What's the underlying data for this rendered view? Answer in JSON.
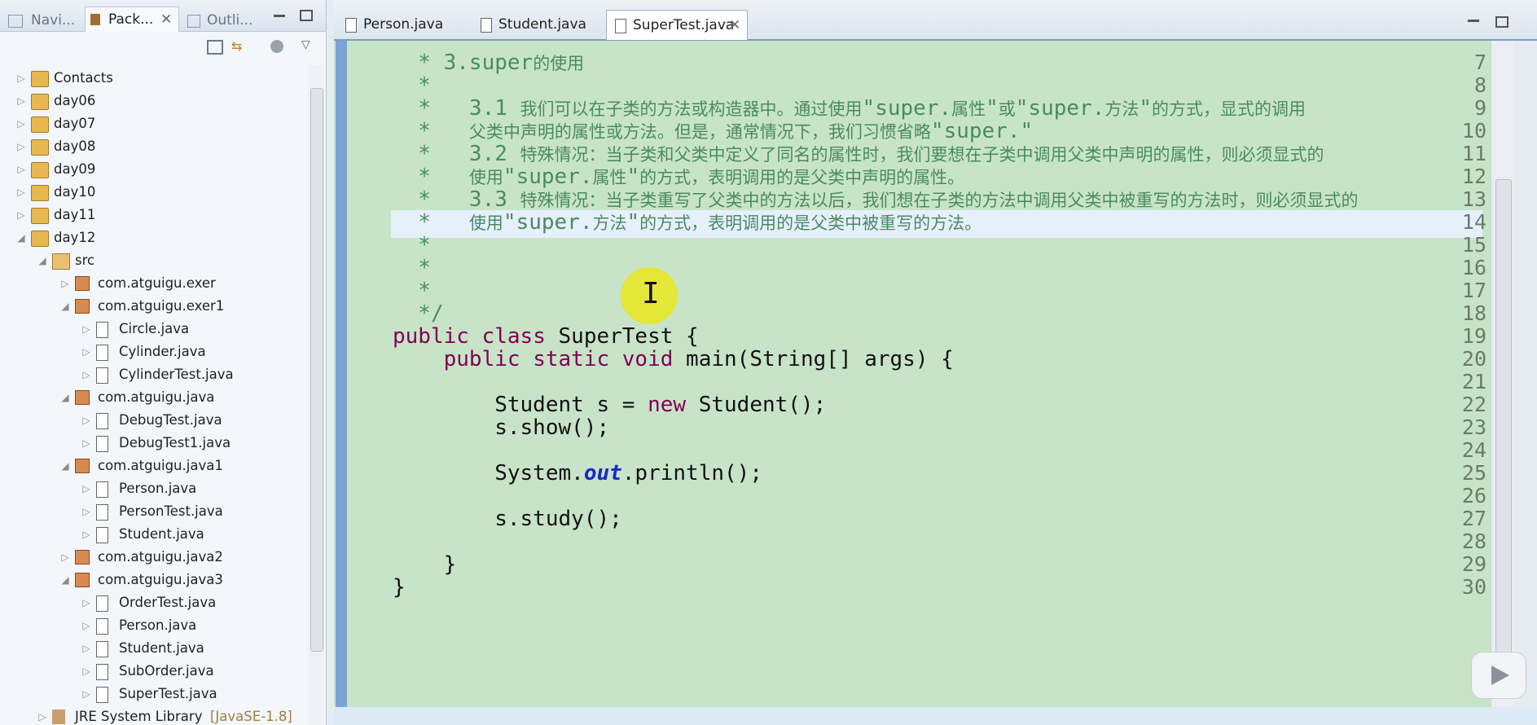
{
  "left_panel": {
    "tabs": [
      {
        "label": "Navi...",
        "icon": "navigator-icon"
      },
      {
        "label": "Pack...",
        "icon": "package-explorer-icon",
        "active": true
      },
      {
        "label": "Outli...",
        "icon": "outline-icon"
      }
    ],
    "tree": [
      {
        "label": "Contacts",
        "level": 0,
        "kind": "project",
        "expanded": false
      },
      {
        "label": "day06",
        "level": 0,
        "kind": "project",
        "expanded": false
      },
      {
        "label": "day07",
        "level": 0,
        "kind": "project",
        "expanded": false
      },
      {
        "label": "day08",
        "level": 0,
        "kind": "project",
        "expanded": false
      },
      {
        "label": "day09",
        "level": 0,
        "kind": "project",
        "expanded": false
      },
      {
        "label": "day10",
        "level": 0,
        "kind": "project",
        "expanded": false
      },
      {
        "label": "day11",
        "level": 0,
        "kind": "project",
        "expanded": false
      },
      {
        "label": "day12",
        "level": 0,
        "kind": "project",
        "expanded": true
      },
      {
        "label": "src",
        "level": 1,
        "kind": "src",
        "expanded": true
      },
      {
        "label": "com.atguigu.exer",
        "level": 2,
        "kind": "package",
        "expanded": false
      },
      {
        "label": "com.atguigu.exer1",
        "level": 2,
        "kind": "package",
        "expanded": true
      },
      {
        "label": "Circle.java",
        "level": 3,
        "kind": "file"
      },
      {
        "label": "Cylinder.java",
        "level": 3,
        "kind": "file"
      },
      {
        "label": "CylinderTest.java",
        "level": 3,
        "kind": "file"
      },
      {
        "label": "com.atguigu.java",
        "level": 2,
        "kind": "package",
        "expanded": true
      },
      {
        "label": "DebugTest.java",
        "level": 3,
        "kind": "file"
      },
      {
        "label": "DebugTest1.java",
        "level": 3,
        "kind": "file"
      },
      {
        "label": "com.atguigu.java1",
        "level": 2,
        "kind": "package",
        "expanded": true
      },
      {
        "label": "Person.java",
        "level": 3,
        "kind": "file"
      },
      {
        "label": "PersonTest.java",
        "level": 3,
        "kind": "file"
      },
      {
        "label": "Student.java",
        "level": 3,
        "kind": "file"
      },
      {
        "label": "com.atguigu.java2",
        "level": 2,
        "kind": "package",
        "expanded": false
      },
      {
        "label": "com.atguigu.java3",
        "level": 2,
        "kind": "package",
        "expanded": true
      },
      {
        "label": "OrderTest.java",
        "level": 3,
        "kind": "file"
      },
      {
        "label": "Person.java",
        "level": 3,
        "kind": "file"
      },
      {
        "label": "Student.java",
        "level": 3,
        "kind": "file"
      },
      {
        "label": "SubOrder.java",
        "level": 3,
        "kind": "file"
      },
      {
        "label": "SuperTest.java",
        "level": 3,
        "kind": "file"
      },
      {
        "label": "JRE System Library",
        "suffix": "[JavaSE-1.8]",
        "level": 1,
        "kind": "library",
        "expanded": false
      }
    ]
  },
  "editor": {
    "tabs": [
      {
        "label": "Person.java",
        "active": false
      },
      {
        "label": "Student.java",
        "active": false
      },
      {
        "label": "SuperTest.java",
        "active": true
      }
    ],
    "highlighted_line": 14,
    "lines": [
      {
        "n": "7",
        "segs": [
          {
            "c": "cm",
            "t": "  * 3.super"
          },
          {
            "c": "cmz",
            "t": "的使用"
          }
        ]
      },
      {
        "n": "8",
        "segs": [
          {
            "c": "cm",
            "t": "  *"
          }
        ]
      },
      {
        "n": "9",
        "segs": [
          {
            "c": "cm",
            "t": "  *   3.1 "
          },
          {
            "c": "cmz",
            "t": "我们可以在子类的方法或构造器中。通过使用"
          },
          {
            "c": "cm",
            "t": "\"super."
          },
          {
            "c": "cmz",
            "t": "属性"
          },
          {
            "c": "cm",
            "t": "\""
          },
          {
            "c": "cmz",
            "t": "或"
          },
          {
            "c": "cm",
            "t": "\"super."
          },
          {
            "c": "cmz",
            "t": "方法"
          },
          {
            "c": "cm",
            "t": "\""
          },
          {
            "c": "cmz",
            "t": "的方式，显式的调用"
          }
        ]
      },
      {
        "n": "10",
        "segs": [
          {
            "c": "cm",
            "t": "  *   "
          },
          {
            "c": "cmz",
            "t": "父类中声明的属性或方法。但是，通常情况下，我们习惯省略"
          },
          {
            "c": "cm",
            "t": "\"super.\""
          }
        ]
      },
      {
        "n": "11",
        "segs": [
          {
            "c": "cm",
            "t": "  *   3.2 "
          },
          {
            "c": "cmz",
            "t": "特殊情况：当子类和父类中定义了同名的属性时，我们要想在子类中调用父类中声明的属性，则必须显式的"
          }
        ]
      },
      {
        "n": "12",
        "segs": [
          {
            "c": "cm",
            "t": "  *   "
          },
          {
            "c": "cmz",
            "t": "使用"
          },
          {
            "c": "cm",
            "t": "\"super."
          },
          {
            "c": "cmz",
            "t": "属性"
          },
          {
            "c": "cm",
            "t": "\""
          },
          {
            "c": "cmz",
            "t": "的方式，表明调用的是父类中声明的属性。"
          }
        ]
      },
      {
        "n": "13",
        "segs": [
          {
            "c": "cm",
            "t": "  *   3.3 "
          },
          {
            "c": "cmz",
            "t": "特殊情况：当子类重写了父类中的方法以后，我们想在子类的方法中调用父类中被重写的方法时，则必须显式的"
          }
        ]
      },
      {
        "n": "14",
        "segs": [
          {
            "c": "cm",
            "t": "  *   "
          },
          {
            "c": "cmz",
            "t": "使用"
          },
          {
            "c": "cm",
            "t": "\"super."
          },
          {
            "c": "cmz",
            "t": "方法"
          },
          {
            "c": "cm",
            "t": "\""
          },
          {
            "c": "cmz",
            "t": "的方式，表明调用的是父类中被重写的方法。"
          }
        ]
      },
      {
        "n": "15",
        "segs": [
          {
            "c": "cm",
            "t": "  *"
          }
        ]
      },
      {
        "n": "16",
        "segs": [
          {
            "c": "cm",
            "t": "  *"
          }
        ]
      },
      {
        "n": "17",
        "segs": [
          {
            "c": "cm",
            "t": "  *"
          }
        ]
      },
      {
        "n": "18",
        "segs": [
          {
            "c": "cm",
            "t": "  */"
          }
        ]
      },
      {
        "n": "19",
        "segs": [
          {
            "c": "kw",
            "t": "public"
          },
          {
            "c": "",
            "t": " "
          },
          {
            "c": "kw",
            "t": "class"
          },
          {
            "c": "",
            "t": " SuperTest {"
          }
        ]
      },
      {
        "n": "20",
        "segs": [
          {
            "c": "",
            "t": "    "
          },
          {
            "c": "kw",
            "t": "public"
          },
          {
            "c": "",
            "t": " "
          },
          {
            "c": "kw",
            "t": "static"
          },
          {
            "c": "",
            "t": " "
          },
          {
            "c": "kw",
            "t": "void"
          },
          {
            "c": "",
            "t": " main(String[] args) {"
          }
        ]
      },
      {
        "n": "21",
        "segs": []
      },
      {
        "n": "22",
        "segs": [
          {
            "c": "",
            "t": "        Student s = "
          },
          {
            "c": "kw",
            "t": "new"
          },
          {
            "c": "",
            "t": " Student();"
          }
        ]
      },
      {
        "n": "23",
        "segs": [
          {
            "c": "",
            "t": "        s.show();"
          }
        ]
      },
      {
        "n": "24",
        "segs": []
      },
      {
        "n": "25",
        "segs": [
          {
            "c": "",
            "t": "        System."
          },
          {
            "c": "out",
            "t": "out"
          },
          {
            "c": "",
            "t": ".println();"
          }
        ]
      },
      {
        "n": "26",
        "segs": []
      },
      {
        "n": "27",
        "segs": [
          {
            "c": "",
            "t": "        s.study();"
          }
        ]
      },
      {
        "n": "28",
        "segs": []
      },
      {
        "n": "29",
        "segs": [
          {
            "c": "",
            "t": "    }"
          }
        ]
      },
      {
        "n": "30",
        "segs": [
          {
            "c": "",
            "t": "}"
          }
        ]
      }
    ]
  },
  "cursor_icon": "text-cursor-icon",
  "overlay": {
    "icon": "video-play-icon"
  }
}
